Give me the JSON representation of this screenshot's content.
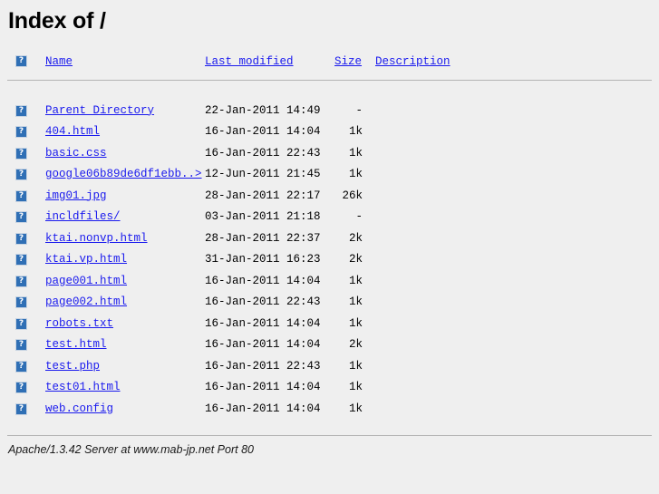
{
  "page": {
    "title": "Index of /",
    "icon_name": "broken-image-icon",
    "link_color": "#1a1aee",
    "background_color": "#efefef",
    "rule_color": "#b4b4b4"
  },
  "table": {
    "headers": {
      "name": "Name",
      "last_modified": "Last modified",
      "size": "Size",
      "description": "Description"
    },
    "rows": [
      {
        "name": "Parent Directory",
        "last_modified": "22-Jan-2011 14:49",
        "size": "-",
        "description": ""
      },
      {
        "name": "404.html",
        "last_modified": "16-Jan-2011 14:04",
        "size": "1k",
        "description": ""
      },
      {
        "name": "basic.css",
        "last_modified": "16-Jan-2011 22:43",
        "size": "1k",
        "description": ""
      },
      {
        "name": "google06b89de6df1ebb..>",
        "last_modified": "12-Jun-2011 21:45",
        "size": "1k",
        "description": ""
      },
      {
        "name": "img01.jpg",
        "last_modified": "28-Jan-2011 22:17",
        "size": "26k",
        "description": ""
      },
      {
        "name": "incldfiles/",
        "last_modified": "03-Jan-2011 21:18",
        "size": "-",
        "description": ""
      },
      {
        "name": "ktai.nonvp.html",
        "last_modified": "28-Jan-2011 22:37",
        "size": "2k",
        "description": ""
      },
      {
        "name": "ktai.vp.html",
        "last_modified": "31-Jan-2011 16:23",
        "size": "2k",
        "description": ""
      },
      {
        "name": "page001.html",
        "last_modified": "16-Jan-2011 14:04",
        "size": "1k",
        "description": ""
      },
      {
        "name": "page002.html",
        "last_modified": "16-Jan-2011 22:43",
        "size": "1k",
        "description": ""
      },
      {
        "name": "robots.txt",
        "last_modified": "16-Jan-2011 14:04",
        "size": "1k",
        "description": ""
      },
      {
        "name": "test.html",
        "last_modified": "16-Jan-2011 14:04",
        "size": "2k",
        "description": ""
      },
      {
        "name": "test.php",
        "last_modified": "16-Jan-2011 22:43",
        "size": "1k",
        "description": ""
      },
      {
        "name": "test01.html",
        "last_modified": "16-Jan-2011 14:04",
        "size": "1k",
        "description": ""
      },
      {
        "name": "web.config",
        "last_modified": "16-Jan-2011 14:04",
        "size": "1k",
        "description": ""
      }
    ]
  },
  "footer": {
    "signature": "Apache/1.3.42 Server at www.mab-jp.net Port 80"
  }
}
